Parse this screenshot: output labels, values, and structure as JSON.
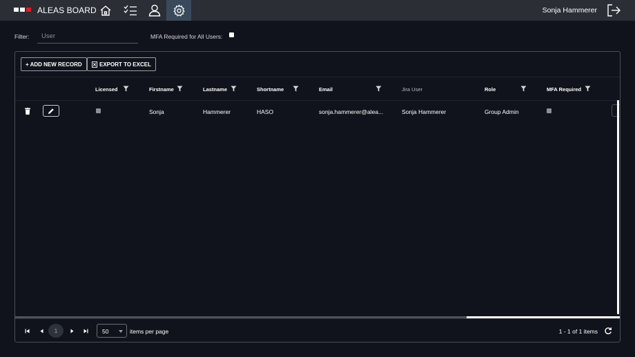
{
  "app": {
    "brand": "ALEAS BOARD",
    "logo_colors": [
      "#ffffff",
      "#ffffff",
      "#e01e26"
    ]
  },
  "nav": {
    "items": [
      {
        "icon": "home-icon"
      },
      {
        "icon": "checklist-icon"
      },
      {
        "icon": "user-icon"
      },
      {
        "icon": "gear-icon",
        "active": true
      }
    ]
  },
  "user": {
    "name": "Sonja Hammerer"
  },
  "filter": {
    "label": "Filter:",
    "placeholder": "User",
    "value": ""
  },
  "mfa_all": {
    "label": "MFA Required for All Users:",
    "checked": false
  },
  "toolbar": {
    "add_label": "+ ADD NEW RECORD",
    "export_label": "EXPORT TO EXCEL"
  },
  "table": {
    "columns": {
      "licensed": "Licensed",
      "firstname": "Firstname",
      "lastname": "Lastname",
      "shortname": "Shortname",
      "email": "Email",
      "jira_user": "Jira User",
      "role": "Role",
      "mfa_required": "MFA Required"
    },
    "rows": [
      {
        "licensed": true,
        "firstname": "Sonja",
        "lastname": "Hammerer",
        "shortname": "HASO",
        "email": "sonja.hammerer@alea...",
        "jira_user": "Sonja Hammerer",
        "role": "Group Admin",
        "mfa_required": false
      }
    ]
  },
  "pager": {
    "current_page": "1",
    "page_size": "50",
    "items_per_page_label": "items per page",
    "range_label": "1 - 1 of 1 items"
  },
  "colors": {
    "background": "#11131c",
    "topbar": "#2b2e35",
    "active_nav": "#3a4a5c",
    "accent_red": "#e01e26"
  }
}
